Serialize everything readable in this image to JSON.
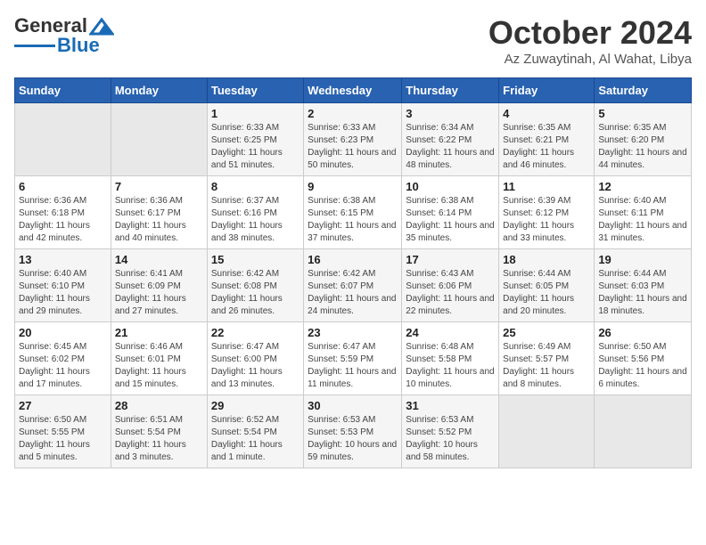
{
  "logo": {
    "part1": "General",
    "part2": "Blue"
  },
  "header": {
    "month": "October 2024",
    "location": "Az Zuwaytinah, Al Wahat, Libya"
  },
  "days_of_week": [
    "Sunday",
    "Monday",
    "Tuesday",
    "Wednesday",
    "Thursday",
    "Friday",
    "Saturday"
  ],
  "weeks": [
    [
      {
        "day": "",
        "info": ""
      },
      {
        "day": "",
        "info": ""
      },
      {
        "day": "1",
        "info": "Sunrise: 6:33 AM\nSunset: 6:25 PM\nDaylight: 11 hours and 51 minutes."
      },
      {
        "day": "2",
        "info": "Sunrise: 6:33 AM\nSunset: 6:23 PM\nDaylight: 11 hours and 50 minutes."
      },
      {
        "day": "3",
        "info": "Sunrise: 6:34 AM\nSunset: 6:22 PM\nDaylight: 11 hours and 48 minutes."
      },
      {
        "day": "4",
        "info": "Sunrise: 6:35 AM\nSunset: 6:21 PM\nDaylight: 11 hours and 46 minutes."
      },
      {
        "day": "5",
        "info": "Sunrise: 6:35 AM\nSunset: 6:20 PM\nDaylight: 11 hours and 44 minutes."
      }
    ],
    [
      {
        "day": "6",
        "info": "Sunrise: 6:36 AM\nSunset: 6:18 PM\nDaylight: 11 hours and 42 minutes."
      },
      {
        "day": "7",
        "info": "Sunrise: 6:36 AM\nSunset: 6:17 PM\nDaylight: 11 hours and 40 minutes."
      },
      {
        "day": "8",
        "info": "Sunrise: 6:37 AM\nSunset: 6:16 PM\nDaylight: 11 hours and 38 minutes."
      },
      {
        "day": "9",
        "info": "Sunrise: 6:38 AM\nSunset: 6:15 PM\nDaylight: 11 hours and 37 minutes."
      },
      {
        "day": "10",
        "info": "Sunrise: 6:38 AM\nSunset: 6:14 PM\nDaylight: 11 hours and 35 minutes."
      },
      {
        "day": "11",
        "info": "Sunrise: 6:39 AM\nSunset: 6:12 PM\nDaylight: 11 hours and 33 minutes."
      },
      {
        "day": "12",
        "info": "Sunrise: 6:40 AM\nSunset: 6:11 PM\nDaylight: 11 hours and 31 minutes."
      }
    ],
    [
      {
        "day": "13",
        "info": "Sunrise: 6:40 AM\nSunset: 6:10 PM\nDaylight: 11 hours and 29 minutes."
      },
      {
        "day": "14",
        "info": "Sunrise: 6:41 AM\nSunset: 6:09 PM\nDaylight: 11 hours and 27 minutes."
      },
      {
        "day": "15",
        "info": "Sunrise: 6:42 AM\nSunset: 6:08 PM\nDaylight: 11 hours and 26 minutes."
      },
      {
        "day": "16",
        "info": "Sunrise: 6:42 AM\nSunset: 6:07 PM\nDaylight: 11 hours and 24 minutes."
      },
      {
        "day": "17",
        "info": "Sunrise: 6:43 AM\nSunset: 6:06 PM\nDaylight: 11 hours and 22 minutes."
      },
      {
        "day": "18",
        "info": "Sunrise: 6:44 AM\nSunset: 6:05 PM\nDaylight: 11 hours and 20 minutes."
      },
      {
        "day": "19",
        "info": "Sunrise: 6:44 AM\nSunset: 6:03 PM\nDaylight: 11 hours and 18 minutes."
      }
    ],
    [
      {
        "day": "20",
        "info": "Sunrise: 6:45 AM\nSunset: 6:02 PM\nDaylight: 11 hours and 17 minutes."
      },
      {
        "day": "21",
        "info": "Sunrise: 6:46 AM\nSunset: 6:01 PM\nDaylight: 11 hours and 15 minutes."
      },
      {
        "day": "22",
        "info": "Sunrise: 6:47 AM\nSunset: 6:00 PM\nDaylight: 11 hours and 13 minutes."
      },
      {
        "day": "23",
        "info": "Sunrise: 6:47 AM\nSunset: 5:59 PM\nDaylight: 11 hours and 11 minutes."
      },
      {
        "day": "24",
        "info": "Sunrise: 6:48 AM\nSunset: 5:58 PM\nDaylight: 11 hours and 10 minutes."
      },
      {
        "day": "25",
        "info": "Sunrise: 6:49 AM\nSunset: 5:57 PM\nDaylight: 11 hours and 8 minutes."
      },
      {
        "day": "26",
        "info": "Sunrise: 6:50 AM\nSunset: 5:56 PM\nDaylight: 11 hours and 6 minutes."
      }
    ],
    [
      {
        "day": "27",
        "info": "Sunrise: 6:50 AM\nSunset: 5:55 PM\nDaylight: 11 hours and 5 minutes."
      },
      {
        "day": "28",
        "info": "Sunrise: 6:51 AM\nSunset: 5:54 PM\nDaylight: 11 hours and 3 minutes."
      },
      {
        "day": "29",
        "info": "Sunrise: 6:52 AM\nSunset: 5:54 PM\nDaylight: 11 hours and 1 minute."
      },
      {
        "day": "30",
        "info": "Sunrise: 6:53 AM\nSunset: 5:53 PM\nDaylight: 10 hours and 59 minutes."
      },
      {
        "day": "31",
        "info": "Sunrise: 6:53 AM\nSunset: 5:52 PM\nDaylight: 10 hours and 58 minutes."
      },
      {
        "day": "",
        "info": ""
      },
      {
        "day": "",
        "info": ""
      }
    ]
  ]
}
